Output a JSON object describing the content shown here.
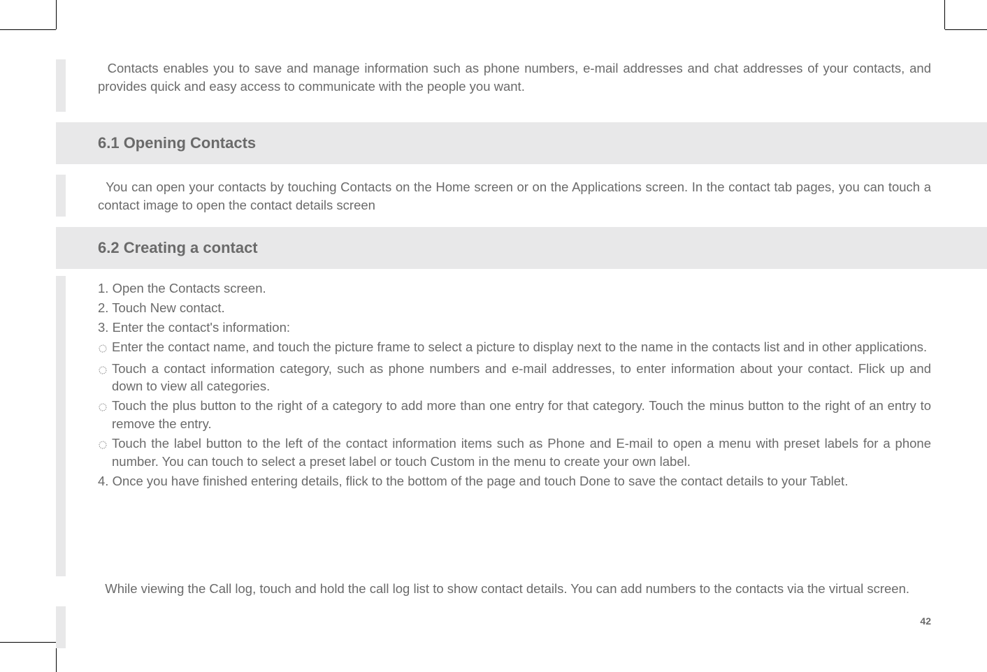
{
  "page_number": "42",
  "intro": "Contacts enables you to save and manage information such as phone numbers, e-mail addresses and chat addresses of your contacts, and provides quick and easy access to communicate with the people you want.",
  "sections": {
    "s61": {
      "heading": "6.1 Opening Contacts",
      "body": "You can open your contacts by touching Contacts on the Home screen or on the Applications screen. In the contact tab pages, you can touch a contact image to open the contact details screen"
    },
    "s62": {
      "heading": "6.2 Creating a contact",
      "steps": {
        "step1": "1. Open the Contacts screen.",
        "step2": "2. Touch New contact.",
        "step3": "3. Enter the contact's information:"
      },
      "bullets": {
        "b1": "Enter the contact name, and touch the picture frame to select a picture to display next to the name in the contacts list and in other applications.",
        "b2": "Touch a contact information category, such as phone numbers and e-mail addresses, to enter information about your contact. Flick up and down to view all categories.",
        "b3": "Touch the plus button to the right of a category to add more than one entry for that category. Touch the minus button to the right of an entry to remove the entry.",
        "b4": "Touch the label button to the left of the contact information items such as Phone and E-mail to open a menu with preset labels for a phone number. You can touch to select a preset label or touch Custom in the menu to create your own label."
      },
      "step4": "4. Once you have finished entering details, flick to the bottom of the page and touch Done to save the contact details to your Tablet.",
      "note": "While viewing the Call log, touch and hold the call log list to show contact details. You can add numbers to the contacts via the virtual screen."
    }
  }
}
